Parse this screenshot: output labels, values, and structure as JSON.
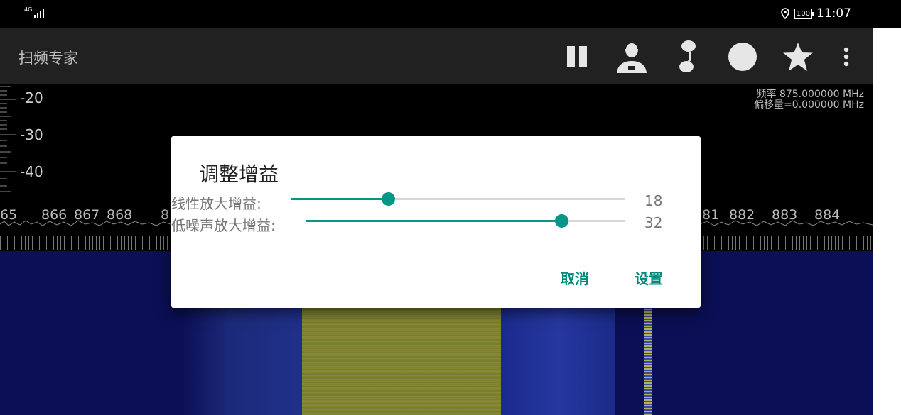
{
  "status_bar": {
    "network": "4G",
    "battery": "100",
    "time": "11:07",
    "icons": [
      "signal-icon",
      "location-icon",
      "battery-icon"
    ]
  },
  "toolbar": {
    "title": "扫频专家",
    "actions": [
      "pause-icon",
      "person-icon",
      "ear-icon",
      "record-circle-icon",
      "star-icon",
      "more-vert-icon"
    ]
  },
  "spectrum": {
    "db_labels": [
      "-20",
      "-30",
      "-40"
    ],
    "freq_line": "频率 875.000000 MHz",
    "offset_line": "偏移量=0.000000 MHz",
    "axis_labels_left": [
      "65",
      "866",
      "867",
      "868",
      "8"
    ],
    "axis_labels_right": [
      "81",
      "882",
      "883",
      "884"
    ]
  },
  "dialog": {
    "title": "调整增益",
    "linear_gain": {
      "label": "线性放大增益:",
      "value": "18",
      "level": 0.29
    },
    "lna_gain": {
      "label": "低噪声放大增益:",
      "value": "32",
      "level": 0.8
    },
    "cancel_label": "取消",
    "confirm_label": "设置"
  },
  "colors": {
    "accent": "#009688",
    "toolbar_bg": "#212121",
    "waterfall_bg": "#0b0f55",
    "signal_band": "#8a8a2a"
  }
}
